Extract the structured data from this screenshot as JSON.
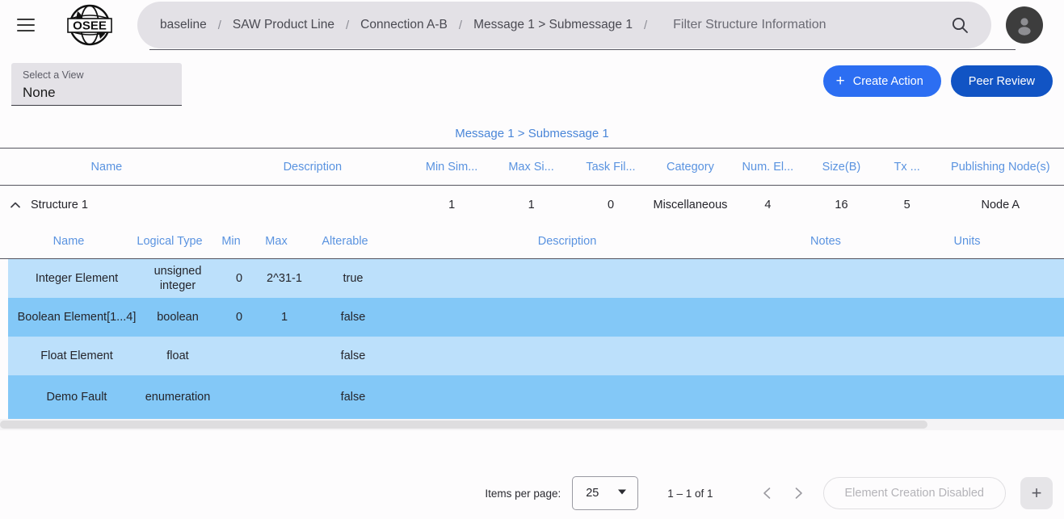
{
  "topbar": {
    "menu_icon": "hamburger-icon",
    "logo_text": "OSEE",
    "breadcrumbs": [
      {
        "label": "baseline"
      },
      {
        "label": "SAW Product Line"
      },
      {
        "label": "Connection A-B"
      },
      {
        "label": "Message 1 > Submessage 1"
      }
    ],
    "separator": "/",
    "filter_placeholder": "Filter Structure Information",
    "filter_value": "",
    "search_icon": "search-icon",
    "avatar_icon": "user-avatar-icon"
  },
  "view_select": {
    "label": "Select a View",
    "value": "None"
  },
  "actions": {
    "create_label": "Create Action",
    "create_plus": "+",
    "peer_label": "Peer Review",
    "create_color": "#2c6ef2",
    "peer_color": "#1154c4"
  },
  "subtitle": {
    "link": "Message 1 > Submessage 1"
  },
  "structure_table": {
    "columns": [
      "Name",
      "Description",
      "Min Sim...",
      "Max Si...",
      "Task Fil...",
      "Category",
      "Num. El...",
      "Size(B)",
      "Tx ...",
      "Publishing Node(s)"
    ],
    "rows": [
      {
        "expanded": true,
        "name": "Structure 1",
        "description": "",
        "min_simultaneity": "1",
        "max_simultaneity": "1",
        "task_file_type": "0",
        "category": "Miscellaneous",
        "num_elements": "4",
        "size_bytes": "16",
        "tx_rate": "5",
        "publishing_nodes": "Node A"
      }
    ]
  },
  "element_table": {
    "columns": [
      "Name",
      "Logical Type",
      "Min",
      "Max",
      "Alterable",
      "Description",
      "Notes",
      "Units"
    ],
    "rows": [
      {
        "name": "Integer Element",
        "logical_type": "unsigned integer",
        "min": "0",
        "max": "2^31-1",
        "alterable": "true",
        "description": "",
        "notes": "",
        "units": ""
      },
      {
        "name": "Boolean Element[1...4]",
        "logical_type": "boolean",
        "min": "0",
        "max": "1",
        "alterable": "false",
        "description": "",
        "notes": "",
        "units": ""
      },
      {
        "name": "Float Element",
        "logical_type": "float",
        "min": "",
        "max": "",
        "alterable": "false",
        "description": "",
        "notes": "",
        "units": ""
      },
      {
        "name": "Demo Fault",
        "logical_type": "enumeration",
        "min": "",
        "max": "",
        "alterable": "false",
        "description": "",
        "notes": "",
        "units": ""
      }
    ],
    "row_color_odd": "#bce0fb",
    "row_color_even": "#83c8f7"
  },
  "paginator": {
    "items_per_page_label": "Items per page:",
    "items_per_page_value": "25",
    "range_label": "1 – 1 of 1",
    "prev_icon": "chevron-left-icon",
    "next_icon": "chevron-right-icon",
    "disabled_button_label": "Element Creation Disabled",
    "add_button_label": "+"
  }
}
